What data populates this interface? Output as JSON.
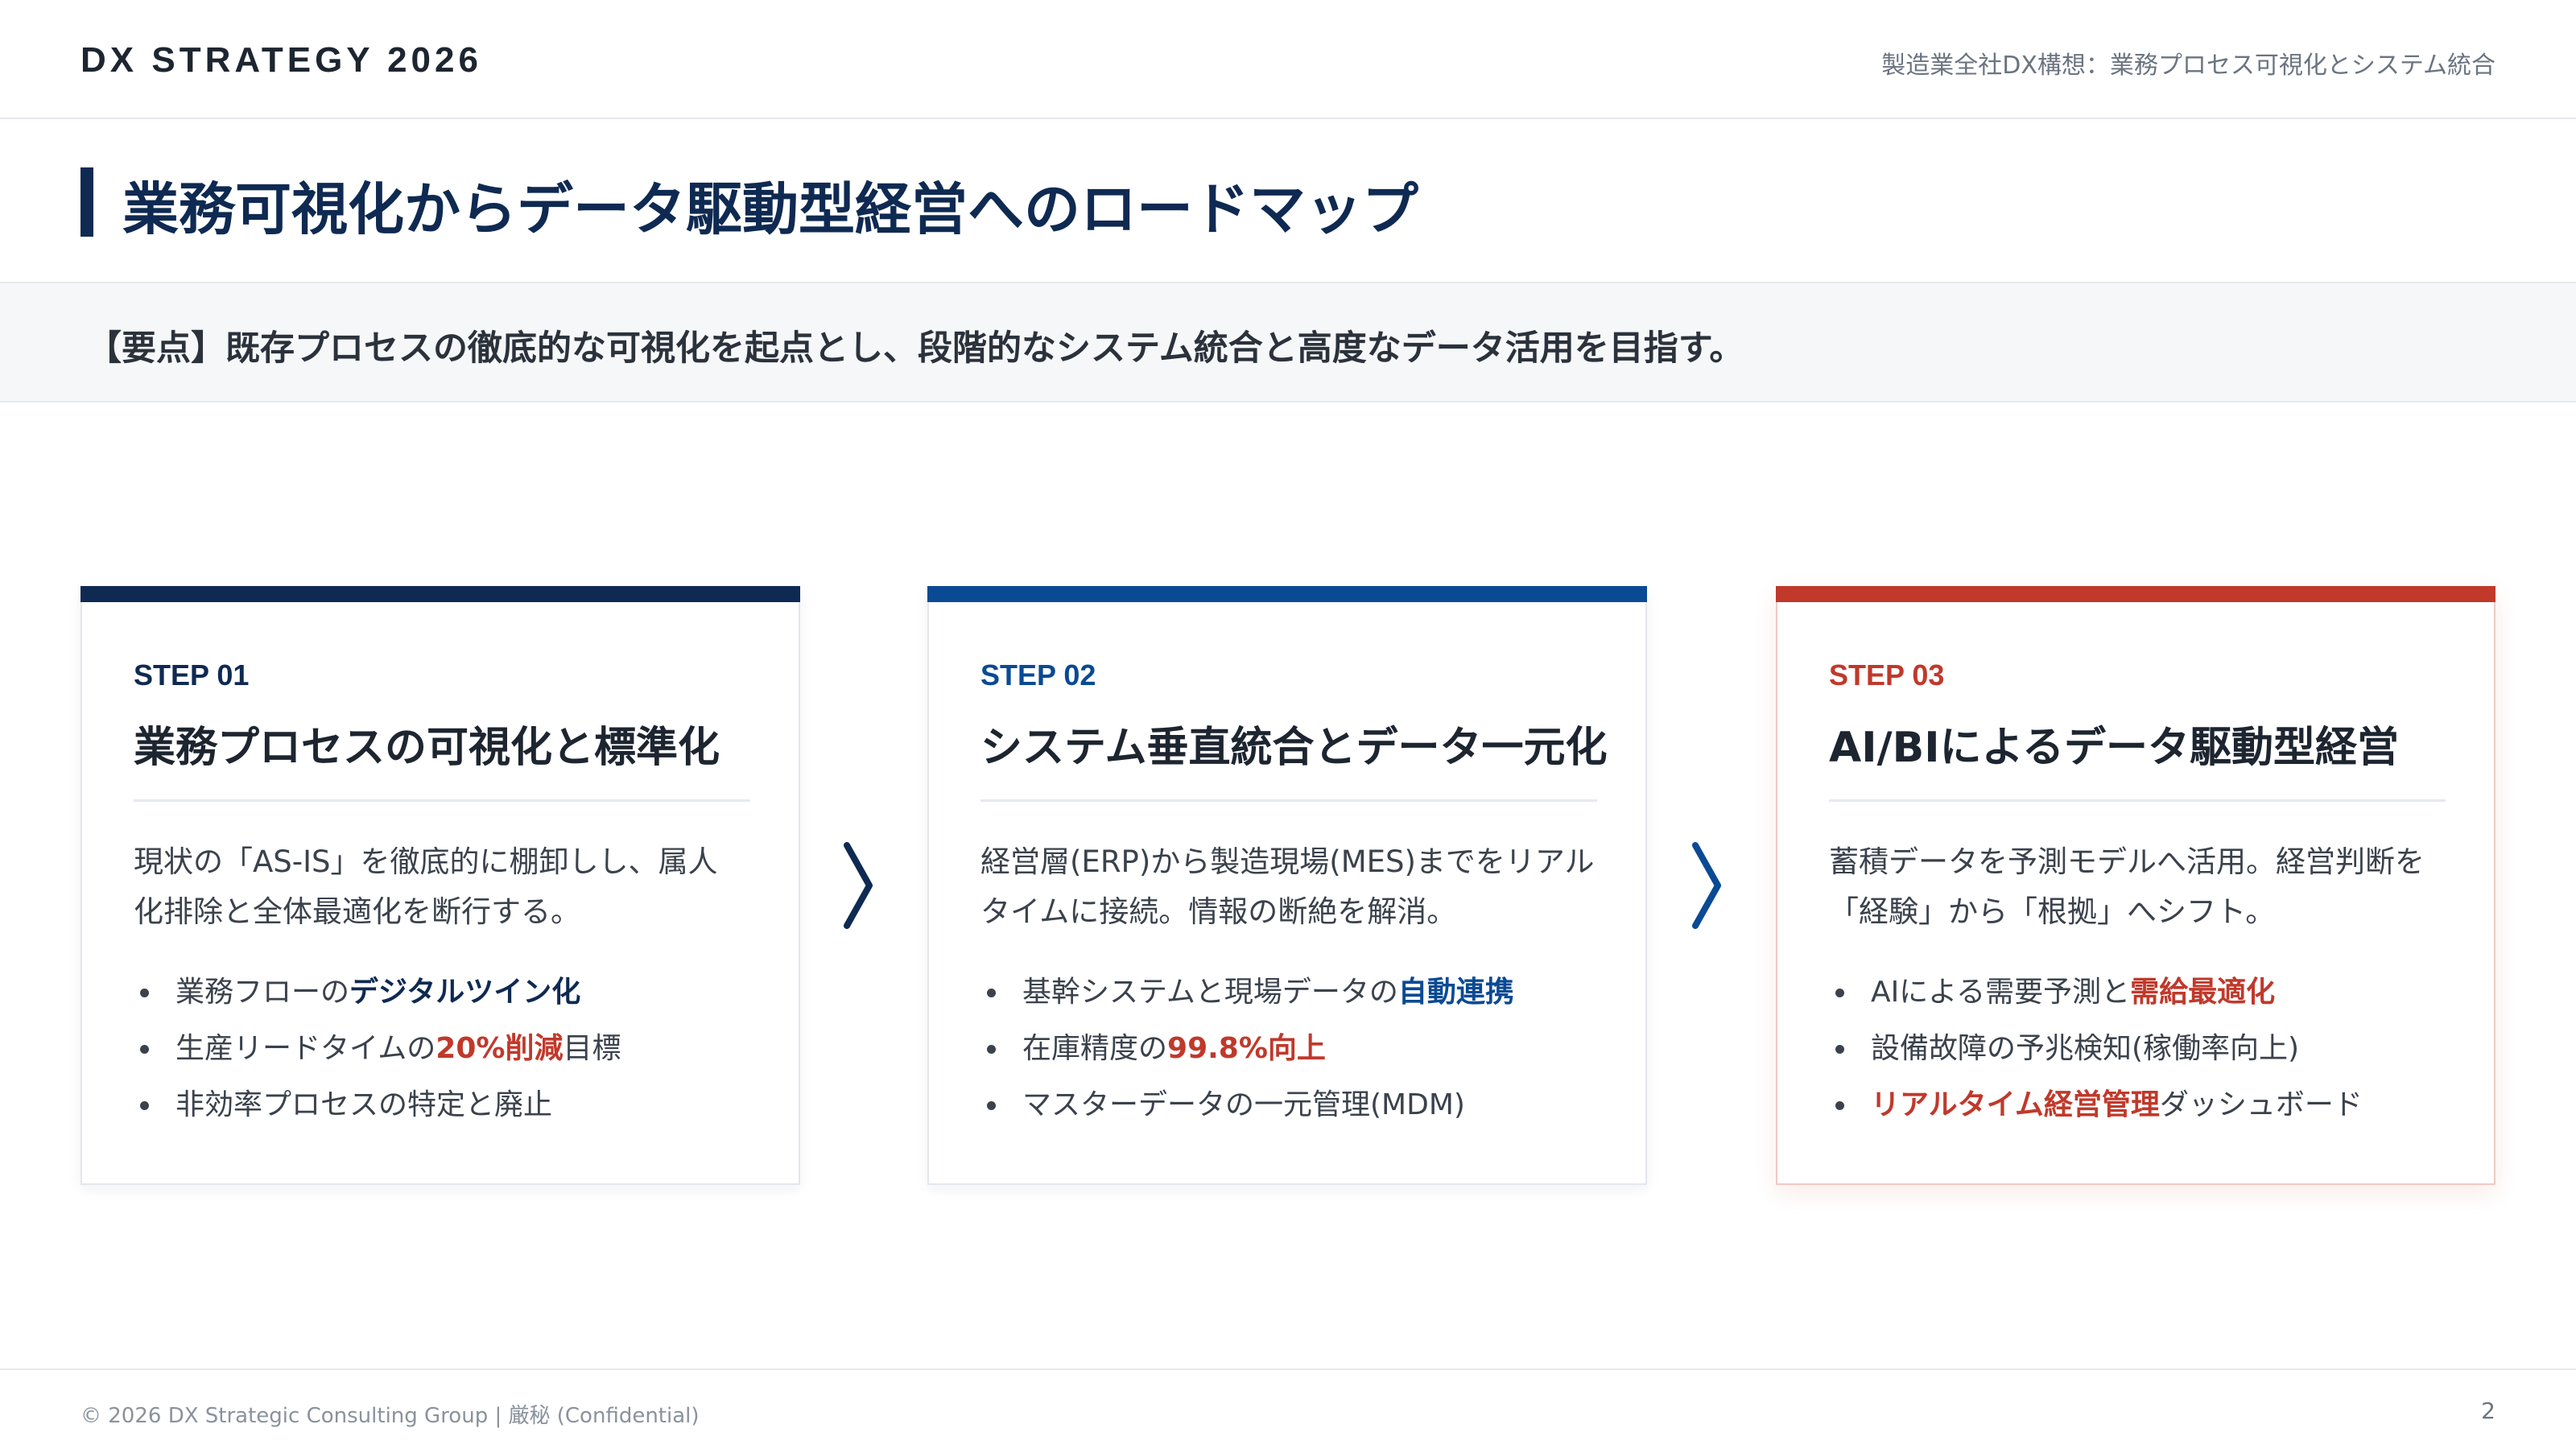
{
  "header": {
    "brand": "DX STRATEGY 2026",
    "subtitle": "製造業全社DX構想：業務プロセス可視化とシステム統合"
  },
  "page_title": "業務可視化からデータ駆動型経営へのロードマップ",
  "summary": "【要点】既存プロセスの徹底的な可視化を起点とし、段階的なシステム統合と高度なデータ活用を目指す。",
  "colors": {
    "navy": "#0f2a52",
    "blue": "#0a4a94",
    "red": "#c0392b"
  },
  "steps": [
    {
      "step": "STEP 01",
      "title": "業務プロセスの可視化と標準化",
      "desc1": "現状の「AS-IS」を徹底的に棚卸しし、属人",
      "desc2": "化排除と全体最適化を断行する。",
      "bullets": [
        {
          "pre": "業務フローの",
          "hl": "デジタルツイン化",
          "post": ""
        },
        {
          "pre": "生産リードタイムの",
          "hl": "20%削減",
          "post": "目標"
        },
        {
          "pre": "非効率プロセスの特定と廃止",
          "hl": "",
          "post": ""
        }
      ]
    },
    {
      "step": "STEP 02",
      "title": "システム垂直統合とデータ一元化",
      "desc1": "経営層(ERP)から製造現場(MES)までをリアル",
      "desc2": "タイムに接続。情報の断絶を解消。",
      "bullets": [
        {
          "pre": "基幹システムと現場データの",
          "hl": "自動連携",
          "post": ""
        },
        {
          "pre": "在庫精度の",
          "hl": "99.8%向上",
          "post": ""
        },
        {
          "pre": "マスターデータの一元管理(MDM)",
          "hl": "",
          "post": ""
        }
      ]
    },
    {
      "step": "STEP 03",
      "title": "AI/BIによるデータ駆動型経営",
      "desc1": "蓄積データを予測モデルへ活用。経営判断を",
      "desc2": "「経験」から「根拠」へシフト。",
      "bullets": [
        {
          "pre": "AIによる需要予測と",
          "hl": "需給最適化",
          "post": ""
        },
        {
          "pre": "設備故障の予兆検知(稼働率向上)",
          "hl": "",
          "post": ""
        },
        {
          "pre": "",
          "hl": "リアルタイム経営管理",
          "post": "ダッシュボード"
        }
      ]
    }
  ],
  "footer": {
    "copyright": "© 2026 DX Strategic Consulting Group | 厳秘 (Confidential)",
    "page": "2"
  }
}
